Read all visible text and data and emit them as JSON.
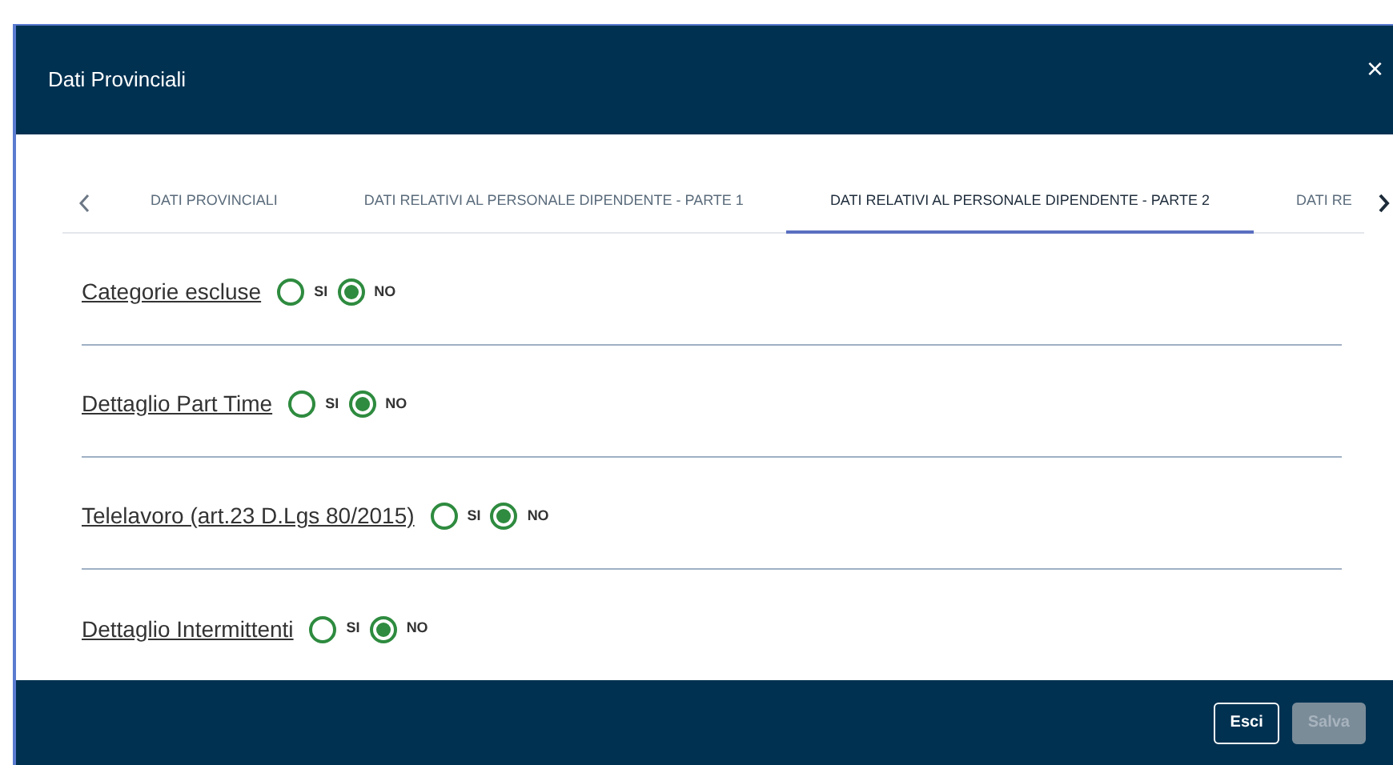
{
  "dialog": {
    "title": "Dati Provinciali",
    "close": "×"
  },
  "tabs": [
    {
      "label": "DATI PROVINCIALI",
      "selected": false
    },
    {
      "label": "DATI RELATIVI AL PERSONALE DIPENDENTE - PARTE 1",
      "selected": false
    },
    {
      "label": "DATI RELATIVI AL PERSONALE DIPENDENTE - PARTE 2",
      "selected": true
    },
    {
      "label": "DATI RE",
      "selected": false
    }
  ],
  "questions": [
    {
      "label": "Categorie escluse",
      "options": [
        {
          "label": "SI",
          "selected": false
        },
        {
          "label": "NO",
          "selected": true
        }
      ]
    },
    {
      "label": "Dettaglio Part Time",
      "options": [
        {
          "label": "SI",
          "selected": false
        },
        {
          "label": "NO",
          "selected": true
        }
      ]
    },
    {
      "label": "Telelavoro (art.23 D.Lgs 80/2015)",
      "options": [
        {
          "label": "SI",
          "selected": false
        },
        {
          "label": "NO",
          "selected": true
        }
      ]
    },
    {
      "label": "Dettaglio Intermittenti",
      "options": [
        {
          "label": "SI",
          "selected": false
        },
        {
          "label": "NO",
          "selected": true
        }
      ]
    }
  ],
  "buttons": [
    {
      "label": "Esci",
      "disabled": false
    },
    {
      "label": "Salva",
      "disabled": true
    }
  ]
}
